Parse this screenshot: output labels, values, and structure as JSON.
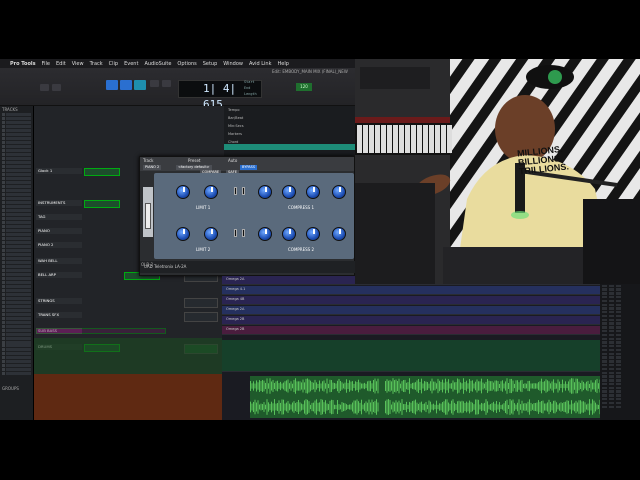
{
  "menubar": {
    "app_name": "Pro Tools",
    "items": [
      "File",
      "Edit",
      "View",
      "Track",
      "Clip",
      "Event",
      "AudioSuite",
      "Options",
      "Setup",
      "Window",
      "Avid Link",
      "Help"
    ]
  },
  "window": {
    "title": "Edit: EMBODY_MAIN MIX (FINAL)_NEW"
  },
  "transport": {
    "counter": "1| 4| 615",
    "start_label": "Start",
    "end_label": "End",
    "length_label": "Length",
    "green_display": "120"
  },
  "tracks_panel": {
    "title": "TRACKS",
    "groups_label": "GROUPS"
  },
  "rulers": {
    "labels": [
      "Tempo",
      "Bar/Beat",
      "Min:Secs",
      "Markers",
      "Chord"
    ]
  },
  "channels": [
    {
      "name": "Glock 1"
    },
    {
      "name": "INSTRUMENTS"
    },
    {
      "name": "TAG"
    },
    {
      "name": "PIANO"
    },
    {
      "name": "PIANO 2"
    },
    {
      "name": "WAH BELL"
    },
    {
      "name": "BELL ARP"
    },
    {
      "name": "STRINGS"
    },
    {
      "name": "TRANS SFX"
    },
    {
      "name": "SUB BASS"
    },
    {
      "name": "DRUMS"
    }
  ],
  "plugin": {
    "track_label": "Track",
    "preset_label": "Preset",
    "auto_label": "Auto",
    "track_value": "PIANO 2",
    "preset_value": "<factory default>",
    "compare_label": "COMPARE",
    "safe_label": "SAFE",
    "bypass_label": "BYPASS",
    "units": [
      {
        "label": "LIMIT 1",
        "label2": "COMPRESS 1"
      },
      {
        "label": "LIMIT 2",
        "label2": "COMPRESS 2"
      }
    ],
    "footer_name": "OLB-2",
    "badge": "UAD Teletronix LA-2A"
  },
  "clips": [
    "Omega 2A",
    "Omega 4.1",
    "Omega 4B",
    "Omega 2A",
    "Omega 2B",
    "Omega 2B"
  ],
  "webcam": {
    "shirt_text": [
      "MILLIONS.",
      "BILLIONS.",
      "TRILLIONS."
    ]
  },
  "colors": {
    "accent_blue": "#2a6fd0",
    "marker_teal": "#1d8c78",
    "waveform_green": "#58c15a"
  }
}
